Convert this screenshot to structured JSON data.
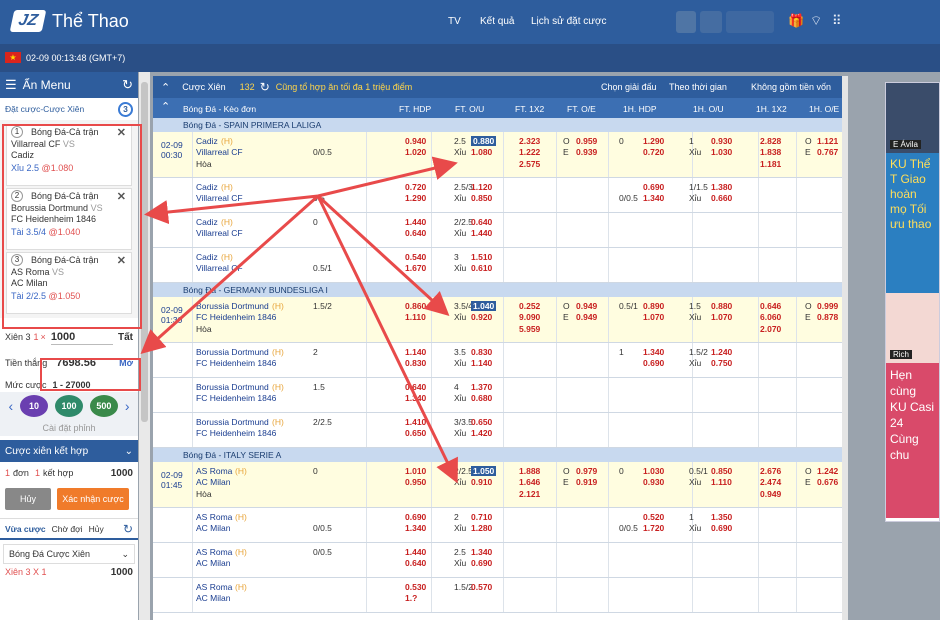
{
  "header": {
    "logo": "JZ",
    "title": "Thể Thao",
    "nav": [
      "TV",
      "Kết quả",
      "Lịch sử đặt cược"
    ]
  },
  "subbar": {
    "flag": "★",
    "time": "02-09 00:13:48 (GMT+7)"
  },
  "left": {
    "menu_label": "Ẩn Menu",
    "section": "Đặt cược-Cược Xiên",
    "section_count": "3",
    "bets": [
      {
        "n": "1",
        "type": "Bóng Đá-Cả trận",
        "home": "Villarreal CF",
        "vs": "VS",
        "away": "Cadiz",
        "sel": "Xỉu 2.5",
        "at": "@",
        "price": "1.080"
      },
      {
        "n": "2",
        "type": "Bóng Đá-Cả trận",
        "home": "Borussia Dortmund",
        "vs": "VS",
        "away": "FC Heidenheim 1846",
        "sel": "Tài 3.5/4",
        "at": "@",
        "price": "1.040"
      },
      {
        "n": "3",
        "type": "Bóng Đá-Cả trận",
        "home": "AS Roma",
        "vs": "VS",
        "away": "AC Milan",
        "sel": "Tài 2/2.5",
        "at": "@",
        "price": "1.050"
      }
    ],
    "parlay_label": "Xiên 3",
    "parlay_mult": "1",
    "times": "×",
    "stake": "1000",
    "all": "Tất",
    "win_label": "Tiền thắng",
    "win_value": "7698.56",
    "more": "Mở",
    "limit_label": "Mức cược",
    "limit_value": "1 - 27000",
    "chips": [
      "10",
      "100",
      "500"
    ],
    "chip_settings": "Cài đặt phỉnh",
    "result_label": "Cược xiên kết hợp",
    "combo_a": "1",
    "combo_a_label": "đơn",
    "combo_b": "1",
    "combo_b_label": "kết hợp",
    "combo_value": "1000",
    "cancel": "Hủy",
    "confirm": "Xác nhận cược",
    "tabs": [
      "Vừa cược",
      "Chờ đợi",
      "Hủy"
    ],
    "history_title": "Bóng Đá Cược Xiên",
    "history_line": "Xiên 3 X 1",
    "history_value": "1000"
  },
  "main": {
    "title": "Cược Xiên",
    "count": "132",
    "note": "Cũng tổ hợp ăn tối đa 1 triệu điểm",
    "filters": [
      "Chọn giải đấu",
      "Theo thời gian",
      "Không gồm tiền vốn"
    ],
    "columns": [
      "Bóng Đá - Kèo đơn",
      "FT. HDP",
      "FT. O/U",
      "FT. 1X2",
      "FT. O/E",
      "1H. HDP",
      "1H. O/U",
      "1H. 1X2",
      "1H. O/E"
    ],
    "leagues": [
      {
        "name": "Bóng Đá - SPAIN PRIMERA LALIGA",
        "matches": [
          {
            "date": "02-09",
            "time": "00:30",
            "home": "Cadiz",
            "away": "Villarreal CF",
            "draw": "Hòa",
            "hl": true,
            "ft_hdp": [
              "",
              "0.940",
              "0/0.5",
              "1.020"
            ],
            "ft_ou": [
              "2.5",
              "0.880",
              "Xỉu",
              "1.080"
            ],
            "x12": [
              "2.323",
              "1.222",
              "2.575"
            ],
            "oe": [
              "O",
              "0.959",
              "E",
              "0.939"
            ],
            "h1_hdp": [
              "0",
              "1.290",
              "",
              "0.720"
            ],
            "h1_ou": [
              "1",
              "0.930",
              "Xỉu",
              "1.030"
            ],
            "h1_x12": [
              "2.828",
              "1.838",
              "1.181"
            ],
            "h1_oe": [
              "O",
              "1.121",
              "E",
              "0.767"
            ]
          },
          {
            "date": "",
            "time": "",
            "home": "Cadiz",
            "away": "Villarreal CF",
            "draw": "",
            "hl": false,
            "ft_hdp": [
              "",
              "0.720",
              "0.5",
              "1.290"
            ],
            "ft_ou": [
              "2.5/3",
              "1.120",
              "Xỉu",
              "0.850"
            ],
            "x12": [
              "",
              "",
              ""
            ],
            "oe": [
              "",
              "",
              "",
              ""
            ],
            "h1_hdp": [
              "",
              "0.690",
              "0/0.5",
              "1.340"
            ],
            "h1_ou": [
              "1/1.5",
              "1.380",
              "Xỉu",
              "0.660"
            ],
            "h1_x12": [
              "",
              "",
              ""
            ],
            "h1_oe": [
              "",
              "",
              "",
              ""
            ]
          },
          {
            "date": "",
            "time": "",
            "home": "Cadiz",
            "away": "Villarreal CF",
            "draw": "",
            "hl": false,
            "ft_hdp": [
              "0",
              "1.440",
              "",
              "0.640"
            ],
            "ft_ou": [
              "2/2.5",
              "0.640",
              "Xỉu",
              "1.440"
            ],
            "x12": [
              "",
              "",
              ""
            ],
            "oe": [
              "",
              "",
              "",
              ""
            ],
            "h1_hdp": [
              "",
              "",
              "",
              ""
            ],
            "h1_ou": [
              "",
              "",
              "",
              ""
            ],
            "h1_x12": [
              "",
              "",
              ""
            ],
            "h1_oe": [
              "",
              "",
              "",
              ""
            ]
          },
          {
            "date": "",
            "time": "",
            "home": "Cadiz",
            "away": "Villarreal CF",
            "draw": "",
            "hl": false,
            "ft_hdp": [
              "",
              "0.540",
              "0.5/1",
              "1.670"
            ],
            "ft_ou": [
              "3",
              "1.510",
              "Xỉu",
              "0.610"
            ],
            "x12": [
              "",
              "",
              ""
            ],
            "oe": [
              "",
              "",
              "",
              ""
            ],
            "h1_hdp": [
              "",
              "",
              "",
              ""
            ],
            "h1_ou": [
              "",
              "",
              "",
              ""
            ],
            "h1_x12": [
              "",
              "",
              ""
            ],
            "h1_oe": [
              "",
              "",
              "",
              ""
            ]
          }
        ]
      },
      {
        "name": "Bóng Đá - GERMANY BUNDESLIGA I",
        "matches": [
          {
            "date": "02-09",
            "time": "01:30",
            "home": "Borussia Dortmund",
            "away": "FC Heidenheim 1846",
            "draw": "Hòa",
            "hl": true,
            "ft_hdp": [
              "1.5/2",
              "0.860",
              "",
              "1.110"
            ],
            "ft_ou": [
              "3.5/4",
              "1.040",
              "Xỉu",
              "0.920"
            ],
            "x12": [
              "0.252",
              "9.090",
              "5.959"
            ],
            "oe": [
              "O",
              "0.949",
              "E",
              "0.949"
            ],
            "h1_hdp": [
              "0.5/1",
              "0.890",
              "",
              "1.070"
            ],
            "h1_ou": [
              "1.5",
              "0.880",
              "Xỉu",
              "1.070"
            ],
            "h1_x12": [
              "0.646",
              "6.060",
              "2.070"
            ],
            "h1_oe": [
              "O",
              "0.999",
              "E",
              "0.878"
            ]
          },
          {
            "date": "",
            "time": "",
            "home": "Borussia Dortmund",
            "away": "FC Heidenheim 1846",
            "draw": "",
            "hl": false,
            "ft_hdp": [
              "2",
              "1.140",
              "",
              "0.830"
            ],
            "ft_ou": [
              "3.5",
              "0.830",
              "Xỉu",
              "1.140"
            ],
            "x12": [
              "",
              "",
              ""
            ],
            "oe": [
              "",
              "",
              "",
              ""
            ],
            "h1_hdp": [
              "1",
              "1.340",
              "",
              "0.690"
            ],
            "h1_ou": [
              "1.5/2",
              "1.240",
              "Xỉu",
              "0.750"
            ],
            "h1_x12": [
              "",
              "",
              ""
            ],
            "h1_oe": [
              "",
              "",
              "",
              ""
            ]
          },
          {
            "date": "",
            "time": "",
            "home": "Borussia Dortmund",
            "away": "FC Heidenheim 1846",
            "draw": "",
            "hl": false,
            "ft_hdp": [
              "1.5",
              "0.640",
              "",
              "1.340"
            ],
            "ft_ou": [
              "4",
              "1.370",
              "Xỉu",
              "0.680"
            ],
            "x12": [
              "",
              "",
              ""
            ],
            "oe": [
              "",
              "",
              "",
              ""
            ],
            "h1_hdp": [
              "",
              "",
              "",
              ""
            ],
            "h1_ou": [
              "",
              "",
              "",
              ""
            ],
            "h1_x12": [
              "",
              "",
              ""
            ],
            "h1_oe": [
              "",
              "",
              "",
              ""
            ]
          },
          {
            "date": "",
            "time": "",
            "home": "Borussia Dortmund",
            "away": "FC Heidenheim 1846",
            "draw": "",
            "hl": false,
            "ft_hdp": [
              "2/2.5",
              "1.410",
              "",
              "0.650"
            ],
            "ft_ou": [
              "3/3.5",
              "0.650",
              "Xỉu",
              "1.420"
            ],
            "x12": [
              "",
              "",
              ""
            ],
            "oe": [
              "",
              "",
              "",
              ""
            ],
            "h1_hdp": [
              "",
              "",
              "",
              ""
            ],
            "h1_ou": [
              "",
              "",
              "",
              ""
            ],
            "h1_x12": [
              "",
              "",
              ""
            ],
            "h1_oe": [
              "",
              "",
              "",
              ""
            ]
          }
        ]
      },
      {
        "name": "Bóng Đá - ITALY SERIE A",
        "matches": [
          {
            "date": "02-09",
            "time": "01:45",
            "home": "AS Roma",
            "away": "AC Milan",
            "draw": "Hòa",
            "hl": true,
            "ft_hdp": [
              "0",
              "1.010",
              "",
              "0.950"
            ],
            "ft_ou": [
              "2/2.5",
              "1.050",
              "Xỉu",
              "0.910"
            ],
            "x12": [
              "1.888",
              "1.646",
              "2.121"
            ],
            "oe": [
              "O",
              "0.979",
              "E",
              "0.919"
            ],
            "h1_hdp": [
              "0",
              "1.030",
              "",
              "0.930"
            ],
            "h1_ou": [
              "0.5/1",
              "0.850",
              "Xỉu",
              "1.110"
            ],
            "h1_x12": [
              "2.676",
              "2.474",
              "0.949"
            ],
            "h1_oe": [
              "O",
              "1.242",
              "E",
              "0.676"
            ]
          },
          {
            "date": "",
            "time": "",
            "home": "AS Roma",
            "away": "AC Milan",
            "draw": "",
            "hl": false,
            "ft_hdp": [
              "",
              "0.690",
              "0/0.5",
              "1.340"
            ],
            "ft_ou": [
              "2",
              "0.710",
              "Xỉu",
              "1.280"
            ],
            "x12": [
              "",
              "",
              ""
            ],
            "oe": [
              "",
              "",
              "",
              ""
            ],
            "h1_hdp": [
              "",
              "0.520",
              "0/0.5",
              "1.720"
            ],
            "h1_ou": [
              "1",
              "1.350",
              "Xỉu",
              "0.690"
            ],
            "h1_x12": [
              "",
              "",
              ""
            ],
            "h1_oe": [
              "",
              "",
              "",
              ""
            ]
          },
          {
            "date": "",
            "time": "",
            "home": "AS Roma",
            "away": "AC Milan",
            "draw": "",
            "hl": false,
            "ft_hdp": [
              "0/0.5",
              "1.440",
              "",
              "0.640"
            ],
            "ft_ou": [
              "2.5",
              "1.340",
              "Xỉu",
              "0.690"
            ],
            "x12": [
              "",
              "",
              ""
            ],
            "oe": [
              "",
              "",
              "",
              ""
            ],
            "h1_hdp": [
              "",
              "",
              "",
              ""
            ],
            "h1_ou": [
              "",
              "",
              "",
              ""
            ],
            "h1_x12": [
              "",
              "",
              ""
            ],
            "h1_oe": [
              "",
              "",
              "",
              ""
            ]
          },
          {
            "date": "",
            "time": "",
            "home": "AS Roma",
            "away": "AC Milan",
            "draw": "",
            "hl": false,
            "ft_hdp": [
              "",
              "0.530",
              "",
              "1.?"
            ],
            "ft_ou": [
              "1.5/2",
              "0.570",
              "",
              ""
            ],
            "x12": [
              "",
              "",
              ""
            ],
            "oe": [
              "",
              "",
              "",
              ""
            ],
            "h1_hdp": [
              "",
              "",
              "",
              ""
            ],
            "h1_ou": [
              "",
              "",
              "",
              ""
            ],
            "h1_x12": [
              "",
              "",
              ""
            ],
            "h1_oe": [
              "",
              "",
              "",
              ""
            ]
          }
        ]
      }
    ]
  },
  "ads": {
    "badge1": "E Ávila",
    "text": "KU Thể T Giao hoàn mọ Tối ưu thao",
    "badge2": "Rich",
    "text2": "Hẹn cùng KU Casi 24 Cùng chu"
  },
  "colors": {
    "brand": "#2e5d9d",
    "odds_red": "#c82020",
    "highlight": "#e84a4a"
  }
}
